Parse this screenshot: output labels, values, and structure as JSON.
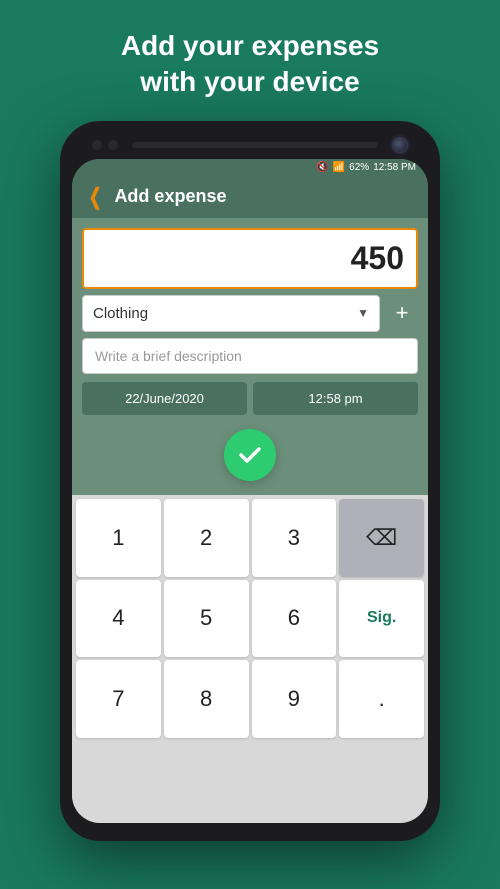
{
  "header": {
    "line1": "Add your expenses",
    "line2": "with your device"
  },
  "status_bar": {
    "mute_icon": "🔇",
    "wifi_icon": "WiFi",
    "signal": "62%",
    "time": "12:58 PM"
  },
  "app": {
    "back_label": "❮",
    "title": "Add expense",
    "amount": "450",
    "category": "Clothing",
    "dropdown_arrow": "▼",
    "add_icon": "+",
    "description_placeholder": "Write a brief description",
    "date": "22/June/2020",
    "time": "12:58 pm",
    "check_label": "✓"
  },
  "keypad": {
    "keys": [
      {
        "label": "1",
        "type": "number"
      },
      {
        "label": "2",
        "type": "number"
      },
      {
        "label": "3",
        "type": "number"
      },
      {
        "label": "⌫",
        "type": "backspace"
      },
      {
        "label": "4",
        "type": "number"
      },
      {
        "label": "5",
        "type": "number"
      },
      {
        "label": "6",
        "type": "number"
      },
      {
        "label": "Sig.",
        "type": "sig"
      },
      {
        "label": "7",
        "type": "number"
      },
      {
        "label": "8",
        "type": "number"
      },
      {
        "label": "9",
        "type": "number"
      },
      {
        "label": ".",
        "type": "dot"
      }
    ]
  }
}
